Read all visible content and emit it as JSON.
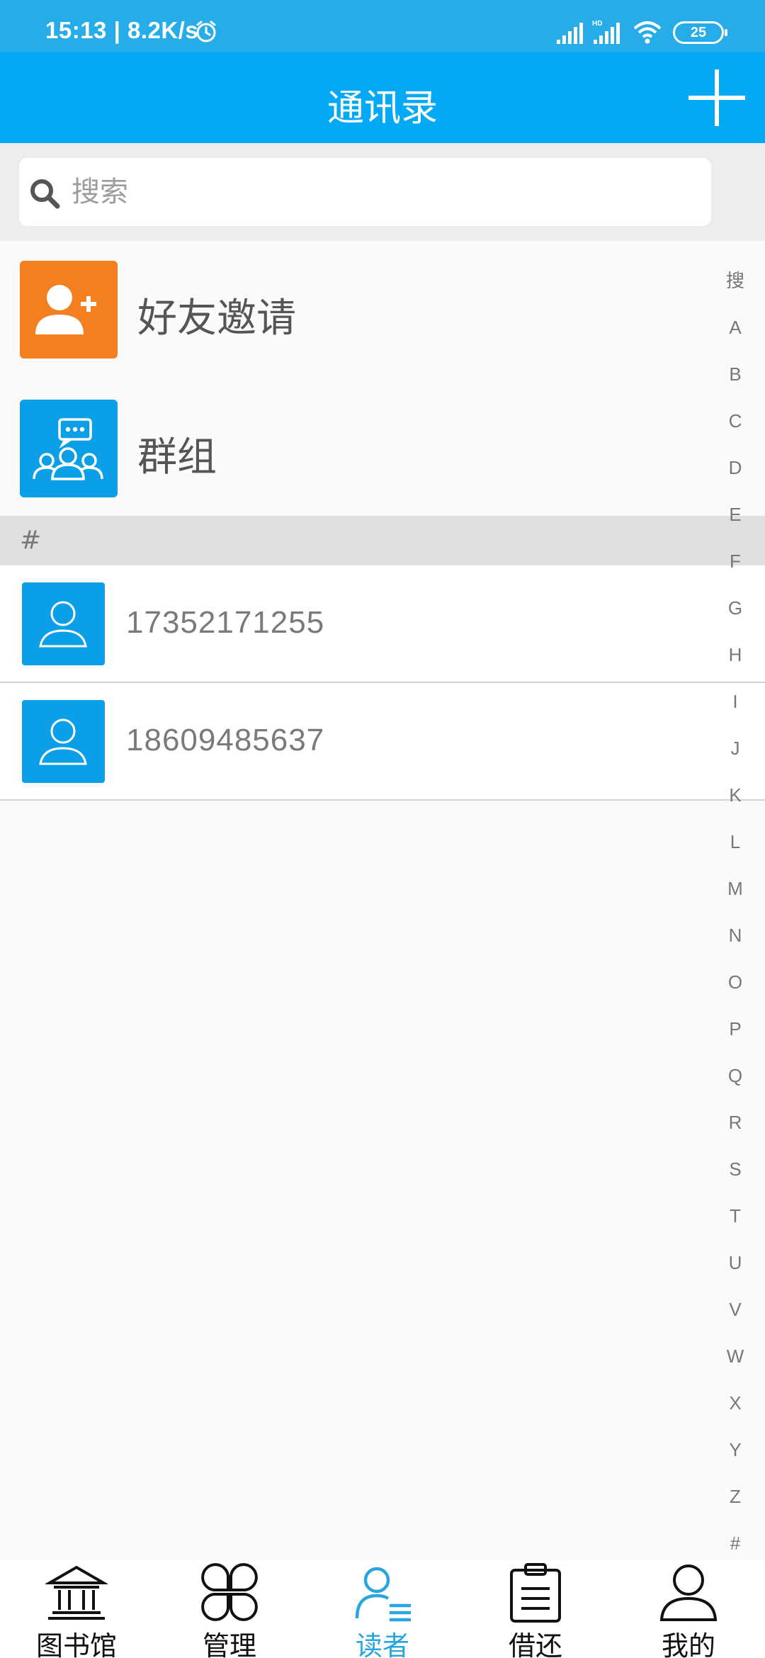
{
  "status_bar": {
    "time": "15:13 | 8.2K/s",
    "battery": "25",
    "signal_label": "HD"
  },
  "header": {
    "title": "通讯录",
    "add_icon": "plus-icon"
  },
  "search": {
    "placeholder": "搜索",
    "value": ""
  },
  "entries": [
    {
      "label": "好友邀请",
      "icon": "add-friend-icon",
      "color": "#f47f20"
    },
    {
      "label": "群组",
      "icon": "group-chat-icon",
      "color": "#0b9fe8"
    }
  ],
  "section": {
    "label": "#"
  },
  "contacts": [
    {
      "name": "17352171255"
    },
    {
      "name": "18609485637"
    }
  ],
  "index_letters": [
    "搜",
    "A",
    "B",
    "C",
    "D",
    "E",
    "F",
    "G",
    "H",
    "I",
    "J",
    "K",
    "L",
    "M",
    "N",
    "O",
    "P",
    "Q",
    "R",
    "S",
    "T",
    "U",
    "V",
    "W",
    "X",
    "Y",
    "Z",
    "#"
  ],
  "bottom_nav": [
    {
      "label": "图书馆",
      "icon": "library-icon",
      "active": false
    },
    {
      "label": "管理",
      "icon": "manage-icon",
      "active": false
    },
    {
      "label": "读者",
      "icon": "reader-icon",
      "active": true
    },
    {
      "label": "借还",
      "icon": "borrow-return-icon",
      "active": false
    },
    {
      "label": "我的",
      "icon": "profile-icon",
      "active": false
    }
  ],
  "colors": {
    "primary": "#03a9f4",
    "status_bar": "#26ace9",
    "accent_active": "#29a6e0",
    "friend_invite": "#f47f20",
    "avatar": "#0b9fe8"
  }
}
